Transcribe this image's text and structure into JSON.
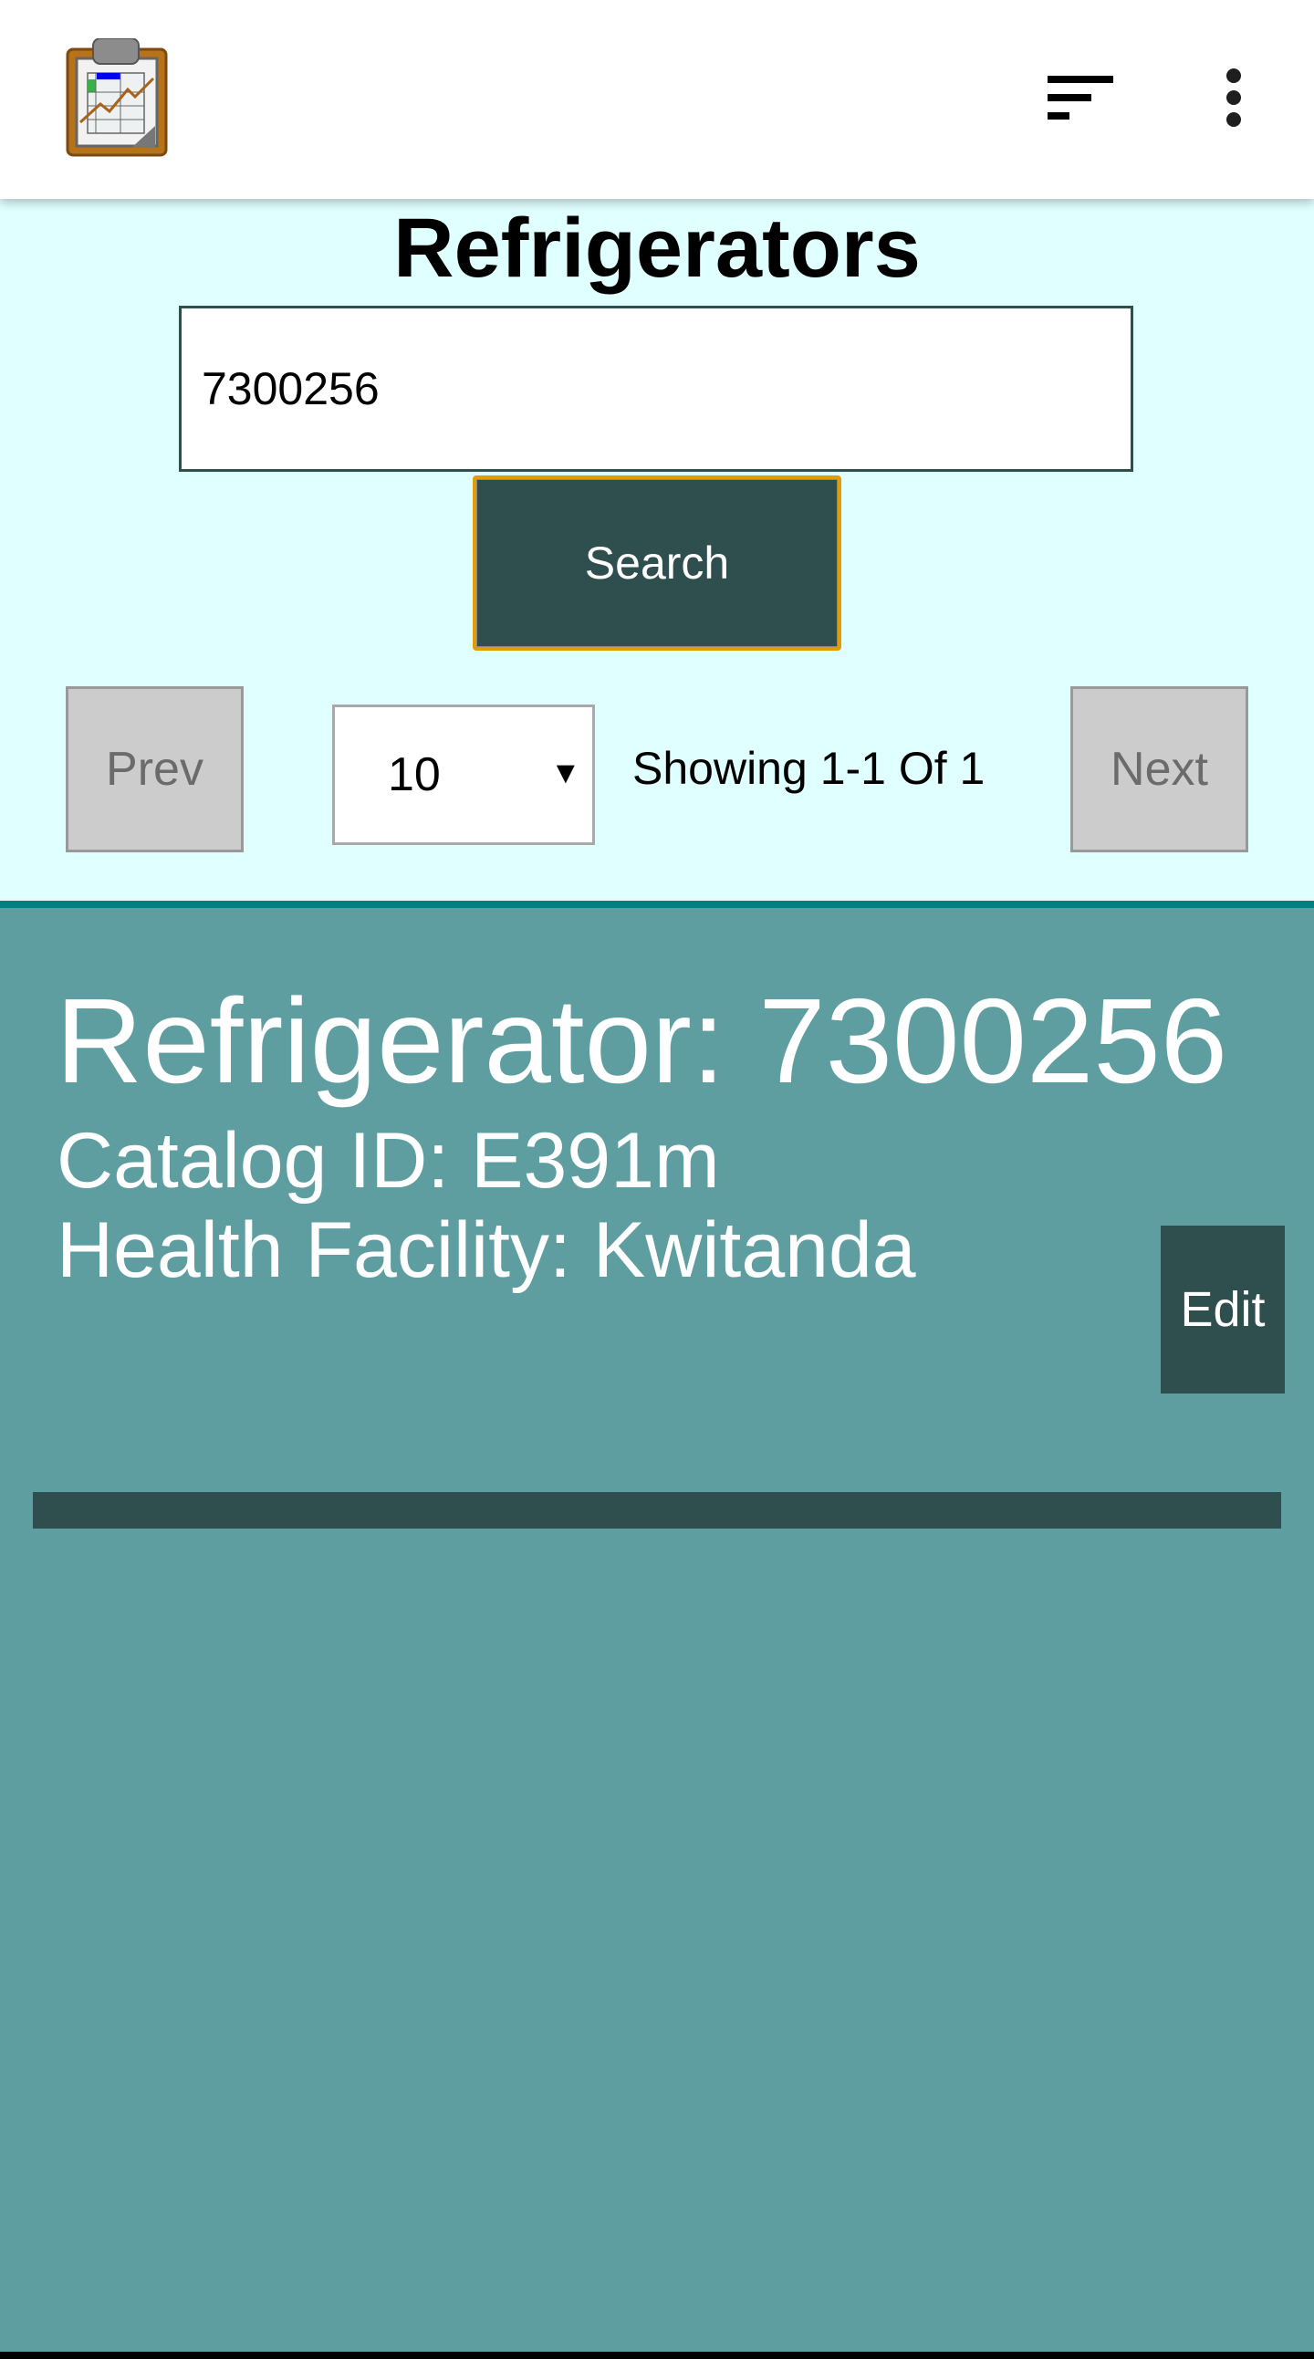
{
  "appbar": {
    "logo_icon": "clipboard-chart-icon",
    "sort_icon": "sort-icon",
    "menu_icon": "more-vert-icon"
  },
  "page": {
    "title": "Refrigerators"
  },
  "search": {
    "value": "7300256",
    "button_label": "Search"
  },
  "pagination": {
    "prev_label": "Prev",
    "next_label": "Next",
    "page_size": "10",
    "dropdown_arrow": "▼",
    "showing_text": "Showing 1-1 Of 1"
  },
  "results": [
    {
      "title": "Refrigerator: 7300256",
      "catalog": "Catalog ID: E391m",
      "facility": "Health Facility: Kwitanda",
      "edit_label": "Edit"
    }
  ],
  "colors": {
    "header_bg": "#ffffff",
    "top_panel_bg": "#e0ffff",
    "body_bg": "#5f9ea0",
    "accent_dark": "#2f4f4f",
    "divider": "#008080",
    "search_border": "#e39b06",
    "disabled_button": "#cccccc"
  }
}
